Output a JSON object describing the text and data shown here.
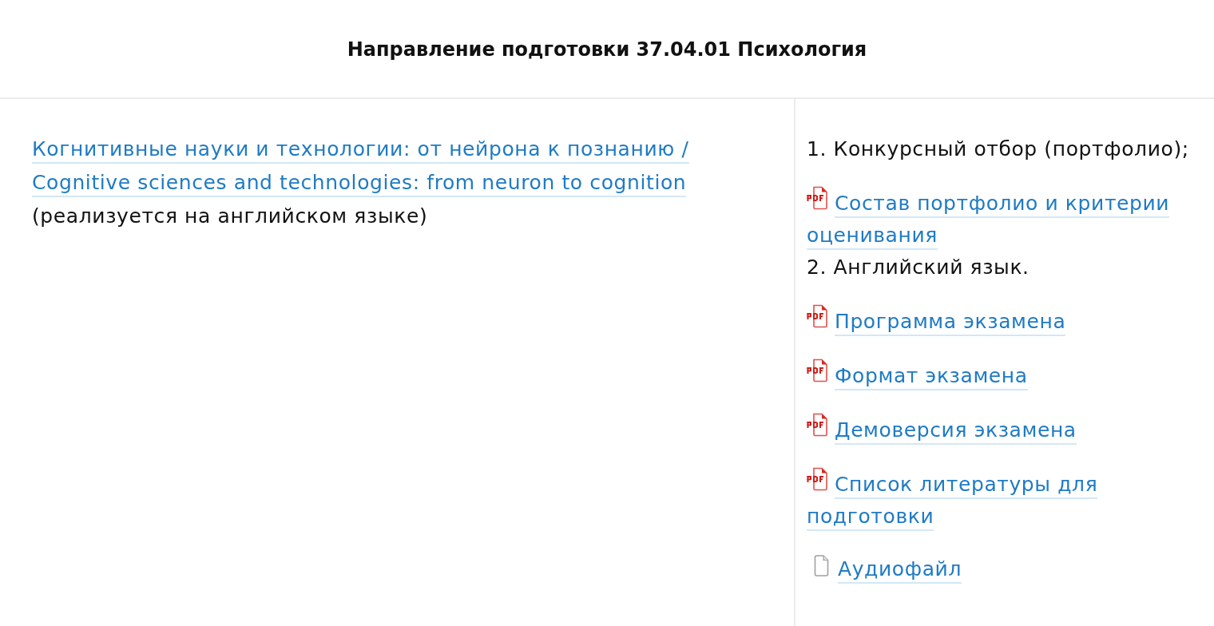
{
  "header": {
    "title": "Направление подготовки 37.04.01 Психология"
  },
  "program": {
    "link_lines": [
      "Когнитивные науки и технологии: от нейрона к познанию /",
      "Cognitive sciences and technologies: from neuron to cognition"
    ],
    "note": "(реализуется на английском языке)"
  },
  "requirements": [
    {
      "kind": "text",
      "text": "1. Конкурсный отбор (портфолио);"
    },
    {
      "kind": "pdf",
      "lines": [
        "Состав портфолио и критерии",
        "оценивания"
      ]
    },
    {
      "kind": "text",
      "text": "2. Английский язык."
    },
    {
      "kind": "pdf",
      "lines": [
        "Программа экзамена"
      ]
    },
    {
      "kind": "pdf",
      "lines": [
        "Формат экзамена"
      ]
    },
    {
      "kind": "pdf",
      "lines": [
        "Демоверсия экзамена"
      ]
    },
    {
      "kind": "pdf",
      "lines": [
        "Список литературы для",
        "подготовки"
      ]
    },
    {
      "kind": "file",
      "lines": [
        "Аудиофайл"
      ]
    }
  ]
}
